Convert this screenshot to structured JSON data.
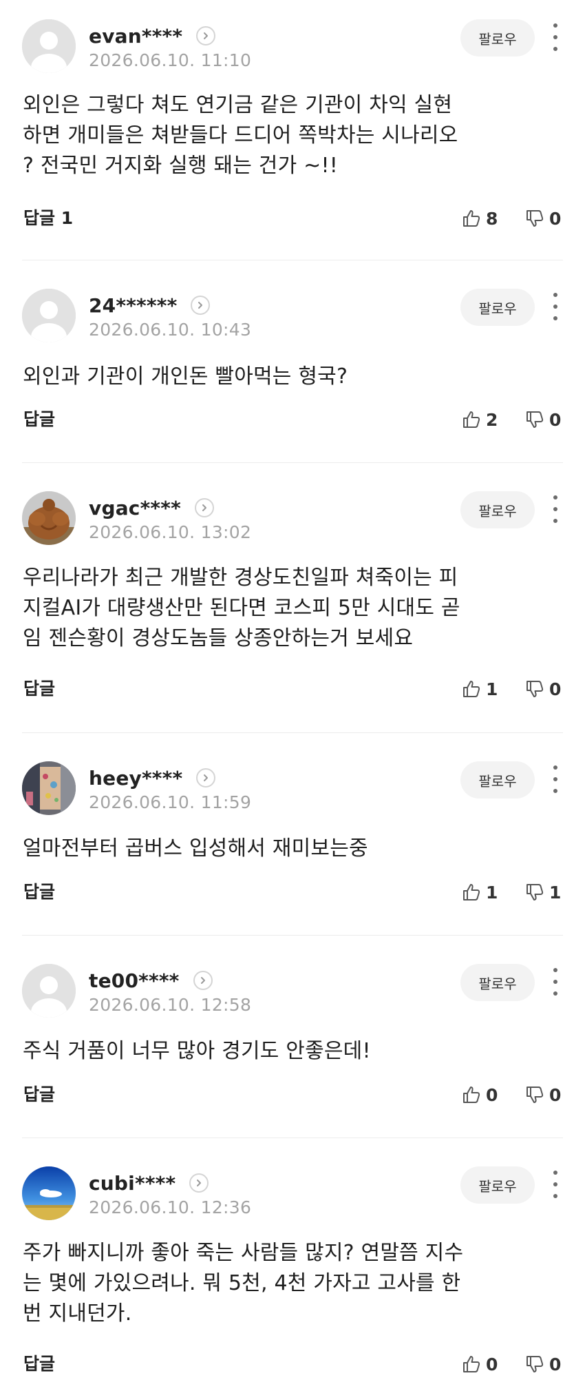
{
  "follow_label": "팔로우",
  "reply_label": "답글",
  "comments": [
    {
      "user": "evan****",
      "date": "2026.06.10. 11:10",
      "avatar": "default-avatar",
      "lines": [
        "외인은 그렇다 쳐도 연기금 같은 기관이 차익 실현",
        "하면 개미들은 쳐받들다 드디어 쪽박차는 시나리오",
        "? 전국민 거지화 실행 돼는 건가 ~!!"
      ],
      "reply_count": "1",
      "likes": "8",
      "dislikes": "0"
    },
    {
      "user": "24******",
      "date": "2026.06.10. 10:43",
      "avatar": "default-avatar",
      "lines": [
        "외인과 기관이 개인돈 빨아먹는 형국?"
      ],
      "reply_count": "",
      "likes": "2",
      "dislikes": "0"
    },
    {
      "user": "vgac****",
      "date": "2026.06.10. 13:02",
      "avatar": "bodybuilder-photo-avatar",
      "lines": [
        "우리나라가 최근 개발한 경상도친일파 쳐죽이는 피",
        "지컬AI가 대량생산만 된다면 코스피 5만 시대도 곧",
        "임 젠슨황이 경상도놈들 상종안하는거 보세요"
      ],
      "reply_count": "",
      "likes": "1",
      "dislikes": "0"
    },
    {
      "user": "heey****",
      "date": "2026.06.10. 11:59",
      "avatar": "wall-photo-avatar",
      "lines": [
        "얼마전부터 곱버스 입성해서 재미보는중"
      ],
      "reply_count": "",
      "likes": "1",
      "dislikes": "1"
    },
    {
      "user": "te00****",
      "date": "2026.06.10. 12:58",
      "avatar": "default-avatar",
      "lines": [
        "주식 거품이 너무 많아 경기도 안좋은데!"
      ],
      "reply_count": "",
      "likes": "0",
      "dislikes": "0"
    },
    {
      "user": "cubi****",
      "date": "2026.06.10. 12:36",
      "avatar": "sky-photo-avatar",
      "lines": [
        "주가 빠지니까 좋아 죽는 사람들 많지? 연말쯤 지수",
        "는 몇에 가있으려나. 뭐 5천, 4천 가자고 고사를 한",
        "번 지내던가."
      ],
      "reply_count": "",
      "likes": "0",
      "dislikes": "0"
    }
  ]
}
